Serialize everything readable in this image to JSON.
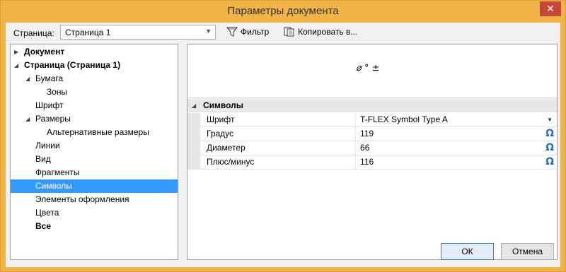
{
  "window": {
    "title": "Параметры документа",
    "close_glyph": "✕"
  },
  "toolbar": {
    "page_label": "Страница:",
    "page_value": "Страница 1",
    "filter_label": "Фильтр",
    "copy_label": "Копировать в..."
  },
  "tree": {
    "items": [
      {
        "label": "Документ",
        "bold": true,
        "twisty": "▶"
      },
      {
        "label": "Страница (Страница 1)",
        "bold": true,
        "twisty": "◢"
      },
      {
        "label": "Бумага",
        "twisty": "◢"
      },
      {
        "label": "Зоны"
      },
      {
        "label": "Шрифт"
      },
      {
        "label": "Размеры",
        "twisty": "◢"
      },
      {
        "label": "Альтернативные размеры"
      },
      {
        "label": "Линии"
      },
      {
        "label": "Вид"
      },
      {
        "label": "Фрагменты"
      },
      {
        "label": "Символы",
        "selected": true
      },
      {
        "label": "Элементы оформления"
      },
      {
        "label": "Цвета"
      },
      {
        "label": "Все",
        "bold": true
      }
    ]
  },
  "preview": {
    "glyphs": "⌀  °  ±"
  },
  "props": {
    "category": "Символы",
    "category_twisty": "◢",
    "rows": [
      {
        "name": "Шрифт",
        "value": "T-FLEX Symbol Type A"
      },
      {
        "name": "Градус",
        "value": "119",
        "omega": "Ω"
      },
      {
        "name": "Диаметер",
        "value": "66",
        "omega": "Ω"
      },
      {
        "name": "Плюс/минус",
        "value": "116",
        "omega": "Ω"
      }
    ]
  },
  "buttons": {
    "ok": "ОК",
    "cancel": "Отмена"
  },
  "colors": {
    "titlebar": "#f0b347",
    "selection": "#3399ff",
    "close": "#c7463a",
    "omega": "#2a6ebb"
  }
}
